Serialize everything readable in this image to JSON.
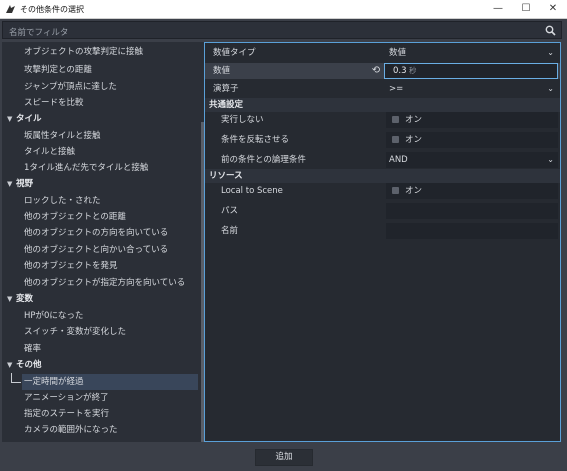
{
  "window": {
    "title": "その他条件の選択",
    "minimize": "—",
    "maximize": "☐",
    "close": "✕"
  },
  "filter": {
    "placeholder": "名前でフィルタ"
  },
  "tree": {
    "top_items": [
      "オブジェクトの攻撃判定に接触",
      "攻撃判定との距離",
      "ジャンプが頂点に達した",
      "スピードを比較"
    ],
    "categories": [
      {
        "label": "タイル",
        "items": [
          "坂属性タイルと接触",
          "タイルと接触",
          "1タイル進んだ先でタイルと接触"
        ]
      },
      {
        "label": "視野",
        "items": [
          "ロックした・された",
          "他のオブジェクトとの距離",
          "他のオブジェクトの方向を向いている",
          "他のオブジェクトと向かい合っている",
          "他のオブジェクトを発見",
          "他のオブジェクトが指定方向を向いている"
        ]
      },
      {
        "label": "変数",
        "items": [
          "HPが0になった",
          "スイッチ・変数が変化した",
          "確率"
        ]
      },
      {
        "label": "その他",
        "items": [
          "一定時間が経過",
          "アニメーションが終了",
          "指定のステートを実行",
          "カメラの範囲外になった"
        ]
      }
    ],
    "selected": "一定時間が経過"
  },
  "props": {
    "value_type": {
      "label": "数値タイプ",
      "value": "数値"
    },
    "value": {
      "label": "数値",
      "value": "0.3",
      "unit": "秒"
    },
    "operator": {
      "label": "演算子",
      "value": ">="
    },
    "common": {
      "header": "共通設定"
    },
    "no_exec": {
      "label": "実行しない",
      "value": "オン"
    },
    "invert": {
      "label": "条件を反転させる",
      "value": "オン"
    },
    "logic": {
      "label": "前の条件との論理条件",
      "value": "AND"
    },
    "resource": {
      "header": "リソース"
    },
    "local": {
      "label": "Local to Scene",
      "value": "オン"
    },
    "path": {
      "label": "パス",
      "value": ""
    },
    "name": {
      "label": "名前",
      "value": ""
    }
  },
  "footer": {
    "add_label": "追加"
  },
  "colors": {
    "accent": "#5aa0d8",
    "selected": "#39465a"
  }
}
